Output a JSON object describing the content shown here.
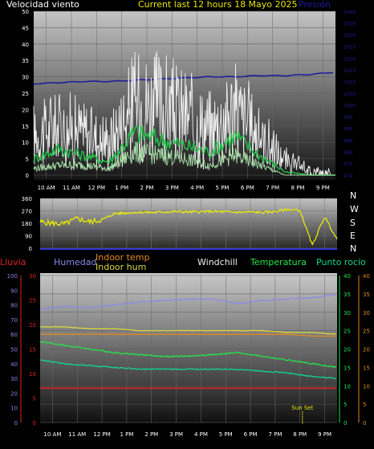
{
  "header": {
    "left_label": "Velocidad viento",
    "center_label": "Current last 12 hours 18 Mayo 2025",
    "right_label": "Presión"
  },
  "colors": {
    "background": "#000000",
    "header_center": "#e6e600",
    "pressure": "#1e1e9a",
    "wind_gust": "#f0f0f0",
    "wind_avg": "#22c84a",
    "wind_light": "#a8e0a8",
    "wind_dir": "#f0f000",
    "rain": "#e02020",
    "humidity": "#8a8ae8",
    "indoor_temp": "#e08a20",
    "indoor_hum": "#d8d840",
    "windchill": "#f0f0f0",
    "temperature": "#22e84a",
    "dewpoint": "#10d890",
    "dir_axis": "#3030e0"
  },
  "x_ticks": [
    "10 AM",
    "11 AM",
    "12 PM",
    "1 PM",
    "2 PM",
    "3 PM",
    "4 PM",
    "5 PM",
    "6 PM",
    "7 PM",
    "8 PM",
    "9 PM"
  ],
  "chart_data": [
    {
      "type": "line",
      "title": "Current last 12 hours 18 Mayo 2025",
      "left_axis": {
        "label": "Velocidad viento",
        "ylim": [
          0,
          50
        ],
        "ticks": [
          "0",
          "5",
          "10",
          "15",
          "20",
          "25",
          "30",
          "35",
          "40",
          "45",
          "50"
        ]
      },
      "right_axis": {
        "label": "Presión",
        "ylim": [
          970,
          1040
        ],
        "ticks": [
          "970",
          "975",
          "980",
          "985",
          "990",
          "995",
          "1000",
          "1005",
          "1010",
          "1015",
          "1020",
          "1025",
          "1030",
          "1035",
          "1040"
        ]
      },
      "x": [
        9.5,
        10.5,
        11.5,
        12.5,
        13.5,
        14.5,
        15.5,
        16.5,
        17.5,
        18.5,
        19.5,
        20.5,
        21.5
      ],
      "series": [
        {
          "name": "Presión",
          "axis": "right",
          "values": [
            1009,
            1009.5,
            1010,
            1010,
            1010.5,
            1011,
            1011.5,
            1012,
            1012,
            1012.5,
            1012.5,
            1013,
            1014
          ]
        },
        {
          "name": "Velocidad viento",
          "axis": "left",
          "values": [
            12,
            15,
            13,
            10,
            22,
            21,
            18,
            14,
            20,
            12,
            4,
            1,
            0
          ]
        },
        {
          "name": "Velocidad viento",
          "axis": "left",
          "values": [
            5,
            8,
            6,
            4,
            13,
            11,
            9,
            7,
            12,
            6,
            1,
            0,
            0
          ]
        },
        {
          "name": "Velocidad viento",
          "axis": "left",
          "values": [
            2,
            3,
            3,
            2,
            7,
            6,
            5,
            3,
            6,
            3,
            0,
            0,
            0
          ]
        }
      ]
    },
    {
      "type": "line",
      "right_labels": [
        "N",
        "W",
        "S",
        "E",
        "N"
      ],
      "left_axis": {
        "ylim": [
          0,
          360
        ],
        "ticks": [
          "0",
          "90",
          "180",
          "270",
          "360"
        ]
      },
      "x": [
        9.5,
        10,
        10.5,
        11,
        11.5,
        12,
        12.5,
        13,
        13.5,
        14,
        14.5,
        15,
        15.5,
        16,
        16.5,
        17,
        17.5,
        18,
        18.5,
        19,
        19.5,
        20,
        20.5,
        21,
        21.5
      ],
      "series": [
        {
          "name": "Dirección",
          "values": [
            190,
            180,
            175,
            215,
            190,
            205,
            250,
            255,
            260,
            258,
            262,
            265,
            262,
            264,
            266,
            262,
            260,
            262,
            258,
            265,
            280,
            272,
            20,
            230,
            60
          ]
        }
      ]
    },
    {
      "type": "line",
      "legend": [
        "Lluvia",
        "Humedad",
        "Indoor temp",
        "Indoor hum",
        "Windchill",
        "Temperatura",
        "Punto rocío",
        "Sun Set"
      ],
      "left_axis_humidity": {
        "ylim": [
          0,
          100
        ],
        "ticks": [
          "0",
          "5",
          "10",
          "15",
          "20",
          "25",
          "30",
          "35",
          "40",
          "45",
          "50",
          "55",
          "60",
          "65",
          "70",
          "75",
          "80",
          "85",
          "90",
          "95",
          "100"
        ]
      },
      "left_axis_rain": {
        "ylim": [
          0,
          30
        ],
        "ticks": [
          "0",
          "5",
          "10",
          "15",
          "20",
          "25",
          "30"
        ]
      },
      "right_axis_temp": {
        "ylim": [
          0,
          40
        ],
        "ticks": [
          "0",
          "5",
          "10",
          "15",
          "20",
          "25",
          "30",
          "35",
          "40"
        ]
      },
      "annotation": "Sun Set",
      "x": [
        9.5,
        10.5,
        11.5,
        12.5,
        13.5,
        14.5,
        15.5,
        16.5,
        17.5,
        18.5,
        19.5,
        20.5,
        21.5
      ],
      "series": [
        {
          "name": "Humedad",
          "values": [
            77,
            79,
            78,
            80,
            82,
            83,
            84,
            84,
            81,
            83,
            84,
            85,
            87
          ]
        },
        {
          "name": "Lluvia",
          "values": [
            7,
            7,
            7,
            7,
            7,
            7,
            7,
            7,
            7,
            7,
            7,
            7,
            7
          ]
        },
        {
          "name": "Indoor temp",
          "values": [
            24,
            24,
            24,
            24,
            24,
            24,
            24,
            24,
            24,
            24,
            24,
            23.5,
            23.5
          ]
        },
        {
          "name": "Indoor hum",
          "values": [
            26,
            26,
            25.5,
            25.5,
            25,
            25,
            25,
            25,
            25,
            25,
            24.5,
            24.5,
            24
          ]
        },
        {
          "name": "Temperatura",
          "values": [
            22,
            21,
            20,
            19,
            18.5,
            18,
            18,
            18.5,
            19,
            18,
            17,
            16,
            15
          ]
        },
        {
          "name": "Punto rocío",
          "values": [
            17,
            16,
            15.5,
            15,
            14.5,
            14.5,
            14.5,
            14.5,
            14.5,
            14,
            13.5,
            12.5,
            12
          ]
        }
      ]
    }
  ]
}
